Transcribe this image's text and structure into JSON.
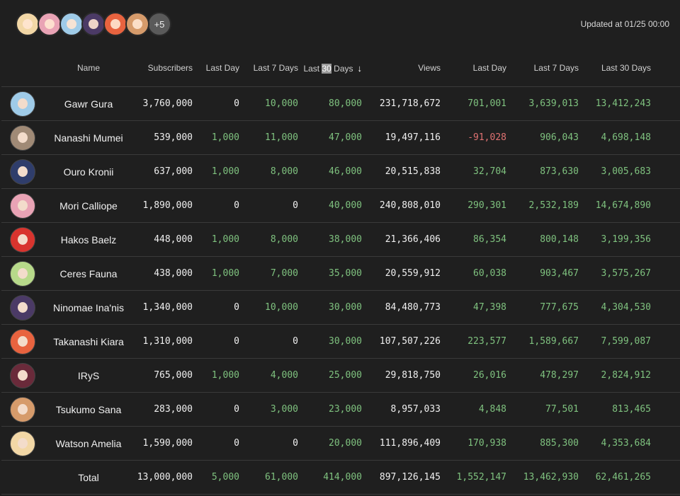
{
  "header": {
    "avatars": [
      {
        "name": "Watson Amelia",
        "color": "#f2d7a6"
      },
      {
        "name": "Mori Calliope",
        "color": "#e9a3b5"
      },
      {
        "name": "Gawr Gura",
        "color": "#9fcbe8"
      },
      {
        "name": "Ninomae Ina'nis",
        "color": "#4b3a66"
      },
      {
        "name": "Takanashi Kiara",
        "color": "#e8633f"
      },
      {
        "name": "Tsukumo Sana",
        "color": "#d69b6b"
      }
    ],
    "more_label": "+5",
    "updated": "Updated at 01/25 00:00"
  },
  "columns": {
    "name": "Name",
    "subscribers": "Subscribers",
    "sub_last_day": "Last Day",
    "sub_last_7": "Last 7 Days",
    "sub_last_30_prefix": "Last ",
    "sub_last_30_hl": "30",
    "sub_last_30_suffix": " Days",
    "sort_icon": "↓",
    "views": "Views",
    "view_last_day": "Last Day",
    "view_last_7": "Last 7 Days",
    "view_last_30": "Last 30 Days"
  },
  "rows": [
    {
      "name": "Gawr Gura",
      "color": "#9fcbe8",
      "subs": "3,760,000",
      "sd": "0",
      "s7": "10,000",
      "s30": "80,000",
      "views": "231,718,672",
      "vd": "701,001",
      "v7": "3,639,013",
      "v30": "13,412,243"
    },
    {
      "name": "Nanashi Mumei",
      "color": "#a08a76",
      "subs": "539,000",
      "sd": "1,000",
      "s7": "11,000",
      "s30": "47,000",
      "views": "19,497,116",
      "vd": "-91,028",
      "v7": "906,043",
      "v30": "4,698,148"
    },
    {
      "name": "Ouro Kronii",
      "color": "#2f3d6b",
      "subs": "637,000",
      "sd": "1,000",
      "s7": "8,000",
      "s30": "46,000",
      "views": "20,515,838",
      "vd": "32,704",
      "v7": "873,630",
      "v30": "3,005,683"
    },
    {
      "name": "Mori Calliope",
      "color": "#e9a3b5",
      "subs": "1,890,000",
      "sd": "0",
      "s7": "0",
      "s30": "40,000",
      "views": "240,808,010",
      "vd": "290,301",
      "v7": "2,532,189",
      "v30": "14,674,890"
    },
    {
      "name": "Hakos Baelz",
      "color": "#d8342e",
      "subs": "448,000",
      "sd": "1,000",
      "s7": "8,000",
      "s30": "38,000",
      "views": "21,366,406",
      "vd": "86,354",
      "v7": "800,148",
      "v30": "3,199,356"
    },
    {
      "name": "Ceres Fauna",
      "color": "#b7d98a",
      "subs": "438,000",
      "sd": "1,000",
      "s7": "7,000",
      "s30": "35,000",
      "views": "20,559,912",
      "vd": "60,038",
      "v7": "903,467",
      "v30": "3,575,267"
    },
    {
      "name": "Ninomae Ina'nis",
      "color": "#4b3a66",
      "subs": "1,340,000",
      "sd": "0",
      "s7": "10,000",
      "s30": "30,000",
      "views": "84,480,773",
      "vd": "47,398",
      "v7": "777,675",
      "v30": "4,304,530"
    },
    {
      "name": "Takanashi Kiara",
      "color": "#e8633f",
      "subs": "1,310,000",
      "sd": "0",
      "s7": "0",
      "s30": "30,000",
      "views": "107,507,226",
      "vd": "223,577",
      "v7": "1,589,667",
      "v30": "7,599,087"
    },
    {
      "name": "IRyS",
      "color": "#6a2a3a",
      "subs": "765,000",
      "sd": "1,000",
      "s7": "4,000",
      "s30": "25,000",
      "views": "29,818,750",
      "vd": "26,016",
      "v7": "478,297",
      "v30": "2,824,912"
    },
    {
      "name": "Tsukumo Sana",
      "color": "#d69b6b",
      "subs": "283,000",
      "sd": "0",
      "s7": "3,000",
      "s30": "23,000",
      "views": "8,957,033",
      "vd": "4,848",
      "v7": "77,501",
      "v30": "813,465"
    },
    {
      "name": "Watson Amelia",
      "color": "#f2d7a6",
      "subs": "1,590,000",
      "sd": "0",
      "s7": "0",
      "s30": "20,000",
      "views": "111,896,409",
      "vd": "170,938",
      "v7": "885,300",
      "v30": "4,353,684"
    }
  ],
  "total": {
    "name": "Total",
    "subs": "13,000,000",
    "sd": "5,000",
    "s7": "61,000",
    "s30": "414,000",
    "views": "897,126,145",
    "vd": "1,552,147",
    "v7": "13,462,930",
    "v30": "62,461,265"
  },
  "colors": {
    "positive": "#7fc27f",
    "negative": "#e07272",
    "background": "#1f1f1f"
  }
}
